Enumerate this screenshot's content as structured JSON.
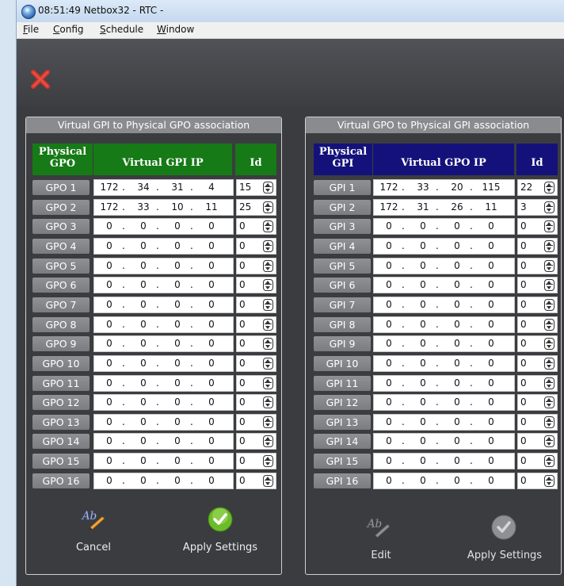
{
  "window": {
    "title": "08:51:49  Netbox32  -  RTC  -"
  },
  "menu": [
    "File",
    "Config",
    "Schedule",
    "Window"
  ],
  "toolbar": {
    "close_icon": "red-x-close-icon"
  },
  "left_panel": {
    "title": "Virtual GPI to Physical GPO association",
    "col_physical_1": "Physical",
    "col_physical_2": "GPO",
    "col_virtual": "Virtual  GPI  IP",
    "col_id": "Id",
    "header_color": "#167a16",
    "rows": [
      {
        "label": "GPO 1",
        "ip": [
          "172",
          "34",
          "31",
          "4"
        ],
        "id": "15"
      },
      {
        "label": "GPO 2",
        "ip": [
          "172",
          "33",
          "10",
          "11"
        ],
        "id": "25"
      },
      {
        "label": "GPO 3",
        "ip": [
          "0",
          "0",
          "0",
          "0"
        ],
        "id": "0"
      },
      {
        "label": "GPO 4",
        "ip": [
          "0",
          "0",
          "0",
          "0"
        ],
        "id": "0"
      },
      {
        "label": "GPO 5",
        "ip": [
          "0",
          "0",
          "0",
          "0"
        ],
        "id": "0"
      },
      {
        "label": "GPO 6",
        "ip": [
          "0",
          "0",
          "0",
          "0"
        ],
        "id": "0"
      },
      {
        "label": "GPO 7",
        "ip": [
          "0",
          "0",
          "0",
          "0"
        ],
        "id": "0"
      },
      {
        "label": "GPO 8",
        "ip": [
          "0",
          "0",
          "0",
          "0"
        ],
        "id": "0"
      },
      {
        "label": "GPO 9",
        "ip": [
          "0",
          "0",
          "0",
          "0"
        ],
        "id": "0"
      },
      {
        "label": "GPO 10",
        "ip": [
          "0",
          "0",
          "0",
          "0"
        ],
        "id": "0"
      },
      {
        "label": "GPO 11",
        "ip": [
          "0",
          "0",
          "0",
          "0"
        ],
        "id": "0"
      },
      {
        "label": "GPO 12",
        "ip": [
          "0",
          "0",
          "0",
          "0"
        ],
        "id": "0"
      },
      {
        "label": "GPO 13",
        "ip": [
          "0",
          "0",
          "0",
          "0"
        ],
        "id": "0"
      },
      {
        "label": "GPO 14",
        "ip": [
          "0",
          "0",
          "0",
          "0"
        ],
        "id": "0"
      },
      {
        "label": "GPO 15",
        "ip": [
          "0",
          "0",
          "0",
          "0"
        ],
        "id": "0"
      },
      {
        "label": "GPO 16",
        "ip": [
          "0",
          "0",
          "0",
          "0"
        ],
        "id": "0"
      }
    ],
    "cancel_label": "Cancel",
    "apply_label": "Apply Settings"
  },
  "right_panel": {
    "title": "Virtual GPO to Physical GPI association",
    "col_physical_1": "Physical",
    "col_physical_2": "GPI",
    "col_virtual": "Virtual  GPO  IP",
    "col_id": "Id",
    "header_color": "#14127a",
    "rows": [
      {
        "label": "GPI 1",
        "ip": [
          "172",
          "33",
          "20",
          "115"
        ],
        "id": "22"
      },
      {
        "label": "GPI 2",
        "ip": [
          "172",
          "31",
          "26",
          "11"
        ],
        "id": "3"
      },
      {
        "label": "GPI 3",
        "ip": [
          "0",
          "0",
          "0",
          "0"
        ],
        "id": "0"
      },
      {
        "label": "GPI 4",
        "ip": [
          "0",
          "0",
          "0",
          "0"
        ],
        "id": "0"
      },
      {
        "label": "GPI 5",
        "ip": [
          "0",
          "0",
          "0",
          "0"
        ],
        "id": "0"
      },
      {
        "label": "GPI 6",
        "ip": [
          "0",
          "0",
          "0",
          "0"
        ],
        "id": "0"
      },
      {
        "label": "GPI 7",
        "ip": [
          "0",
          "0",
          "0",
          "0"
        ],
        "id": "0"
      },
      {
        "label": "GPI 8",
        "ip": [
          "0",
          "0",
          "0",
          "0"
        ],
        "id": "0"
      },
      {
        "label": "GPI 9",
        "ip": [
          "0",
          "0",
          "0",
          "0"
        ],
        "id": "0"
      },
      {
        "label": "GPI 10",
        "ip": [
          "0",
          "0",
          "0",
          "0"
        ],
        "id": "0"
      },
      {
        "label": "GPI 11",
        "ip": [
          "0",
          "0",
          "0",
          "0"
        ],
        "id": "0"
      },
      {
        "label": "GPI 12",
        "ip": [
          "0",
          "0",
          "0",
          "0"
        ],
        "id": "0"
      },
      {
        "label": "GPI 13",
        "ip": [
          "0",
          "0",
          "0",
          "0"
        ],
        "id": "0"
      },
      {
        "label": "GPI 14",
        "ip": [
          "0",
          "0",
          "0",
          "0"
        ],
        "id": "0"
      },
      {
        "label": "GPI 15",
        "ip": [
          "0",
          "0",
          "0",
          "0"
        ],
        "id": "0"
      },
      {
        "label": "GPI 16",
        "ip": [
          "0",
          "0",
          "0",
          "0"
        ],
        "id": "0"
      }
    ],
    "edit_label": "Edit",
    "apply_label": "Apply Settings"
  }
}
